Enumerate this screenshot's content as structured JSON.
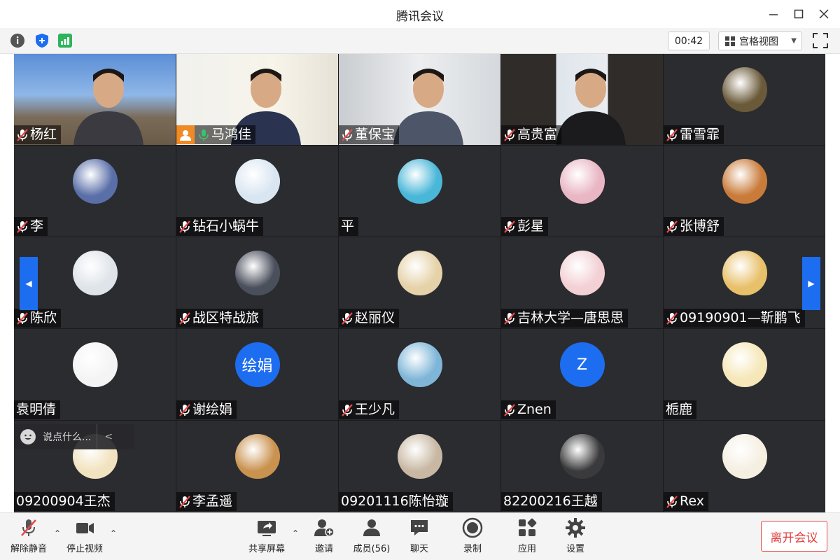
{
  "window": {
    "title": "腾讯会议"
  },
  "toolbar": {
    "timer": "00:42",
    "view_mode": "宫格视图"
  },
  "participants": [
    {
      "name": "杨红",
      "video": true,
      "muted": true
    },
    {
      "name": "马鸿佳",
      "video": true,
      "muted": false,
      "sharing": true
    },
    {
      "name": "董保宝",
      "video": true,
      "muted": true
    },
    {
      "name": "高贵富",
      "video": true,
      "muted": true
    },
    {
      "name": "雷雪霏",
      "muted": true,
      "avatar_color": "#6b5a3a"
    },
    {
      "name": "李",
      "muted": true,
      "avatar_color": "#5a6fa8"
    },
    {
      "name": "钻石小蜗牛",
      "muted": true,
      "avatar_color": "#d9e6f2"
    },
    {
      "name": "平",
      "muted": false,
      "avatar_color": "#4ab7d8"
    },
    {
      "name": "彭星",
      "muted": true,
      "avatar_color": "#e9b6c4"
    },
    {
      "name": "张博舒",
      "muted": true,
      "avatar_color": "#c97b3a"
    },
    {
      "name": "陈欣",
      "muted": true,
      "avatar_color": "#dfe4ea"
    },
    {
      "name": "战区特战旅",
      "muted": true,
      "avatar_color": "#4a4f5c"
    },
    {
      "name": "赵丽仪",
      "muted": true,
      "avatar_color": "#e5d2a8"
    },
    {
      "name": "吉林大学—唐思思",
      "muted": true,
      "avatar_color": "#f3d0d4"
    },
    {
      "name": "09190901—靳鹏飞",
      "muted": true,
      "avatar_color": "#e8c06a"
    },
    {
      "name": "袁明倩",
      "muted": false,
      "avatar_color": "#f4f4f4"
    },
    {
      "name": "谢绘娟",
      "muted": true,
      "avatar_text": "绘娟"
    },
    {
      "name": "王少凡",
      "muted": true,
      "avatar_color": "#7fb6d8"
    },
    {
      "name": "Znen",
      "muted": true,
      "avatar_text": "Z"
    },
    {
      "name": "栀鹿",
      "muted": false,
      "avatar_color": "#f6e7b8"
    },
    {
      "name": "09200904王杰",
      "muted": false,
      "avatar_color": "#f2e3c0"
    },
    {
      "name": "李孟遥",
      "muted": true,
      "avatar_color": "#c9924f"
    },
    {
      "name": "09201116陈怡璇",
      "muted": false,
      "avatar_color": "#c8b8a3"
    },
    {
      "name": "82200216王越",
      "muted": false,
      "avatar_color": "#3a3a3c"
    },
    {
      "name": "Rex",
      "muted": true,
      "avatar_color": "#f5efe2"
    }
  ],
  "chat": {
    "placeholder": "说点什么..."
  },
  "bottombar": {
    "unmute": "解除静音",
    "stop_video": "停止视频",
    "share_screen": "共享屏幕",
    "invite": "邀请",
    "members": "成员(56)",
    "chat": "聊天",
    "record": "录制",
    "apps": "应用",
    "settings": "设置",
    "leave": "离开会议"
  },
  "colors": {
    "accent": "#1d6df0",
    "leave": "#e03c3c",
    "tile_bg": "#2b2c30",
    "mute_red": "#e84a4a"
  }
}
